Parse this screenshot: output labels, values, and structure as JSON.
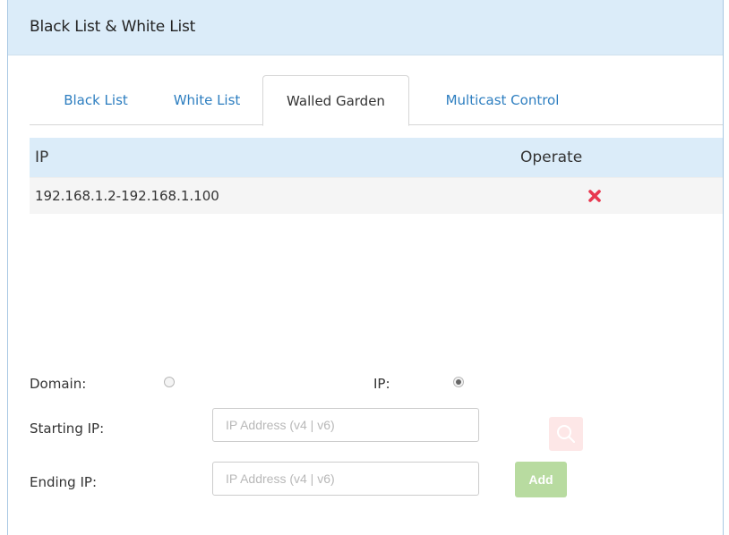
{
  "panel": {
    "title": "Black List & White List"
  },
  "tabs": [
    {
      "label": "Black List",
      "active": false
    },
    {
      "label": "White List",
      "active": false
    },
    {
      "label": "Walled Garden",
      "active": true
    },
    {
      "label": "Multicast Control",
      "active": false
    }
  ],
  "table": {
    "columns": [
      "IP",
      "Operate"
    ],
    "rows": [
      {
        "ip": "192.168.1.2-192.168.1.100",
        "operate_icon": "delete-icon"
      }
    ]
  },
  "form": {
    "domain_label": "Domain:",
    "domain_selected": false,
    "ip_label": "IP:",
    "ip_selected": true,
    "starting_ip_label": "Starting IP:",
    "starting_ip_placeholder": "IP Address (v4 | v6)",
    "starting_ip_value": "",
    "ending_ip_label": "Ending IP:",
    "ending_ip_placeholder": "IP Address (v4 | v6)",
    "ending_ip_value": "",
    "add_label": "Add",
    "search_icon": "search-icon"
  },
  "colors": {
    "header_bg": "#dbecf9",
    "tab_link": "#2d7ec0",
    "delete_red": "#e8384f",
    "add_green": "#b8dba0",
    "search_bg": "#fde7e7"
  }
}
